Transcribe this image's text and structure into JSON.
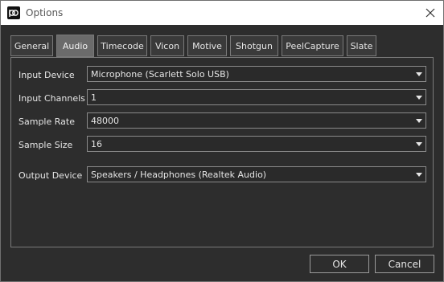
{
  "window": {
    "title": "Options"
  },
  "tabs": [
    {
      "label": "General",
      "active": false
    },
    {
      "label": "Audio",
      "active": true
    },
    {
      "label": "Timecode",
      "active": false
    },
    {
      "label": "Vicon",
      "active": false
    },
    {
      "label": "Motive",
      "active": false
    },
    {
      "label": "Shotgun",
      "active": false
    },
    {
      "label": "PeelCapture",
      "active": false
    },
    {
      "label": "Slate",
      "active": false
    }
  ],
  "audio": {
    "input_device": {
      "label": "Input Device",
      "value": "Microphone (Scarlett Solo USB)"
    },
    "input_channels": {
      "label": "Input Channels",
      "value": "1"
    },
    "sample_rate": {
      "label": "Sample Rate",
      "value": "48000"
    },
    "sample_size": {
      "label": "Sample Size",
      "value": "16"
    },
    "output_device": {
      "label": "Output Device",
      "value": "Speakers / Headphones (Realtek Audio)"
    }
  },
  "buttons": {
    "ok": "OK",
    "cancel": "Cancel"
  },
  "icons": {
    "app": "app-logo-icon",
    "close": "close-icon",
    "dropdown": "chevron-down-icon"
  }
}
